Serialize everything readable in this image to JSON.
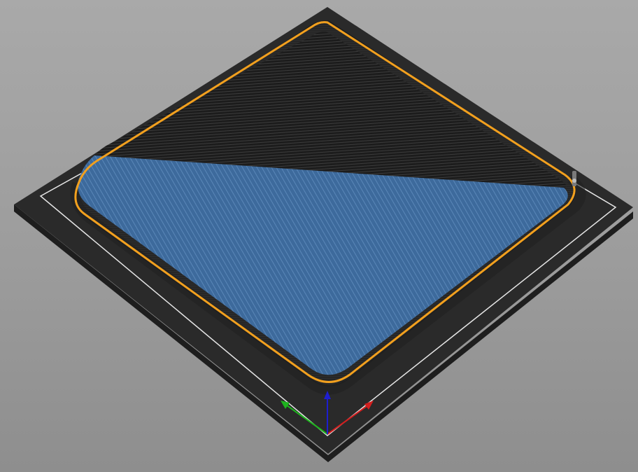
{
  "viewport": {
    "background_top": "#a9a9a9",
    "background_bottom": "#8e8e8e"
  },
  "bed": {
    "surface_color": "#2a2a2a",
    "edge_color": "#1e1e1e",
    "boundary_line_color": "#e6e6e6"
  },
  "print": {
    "wall_color": "#262626",
    "wall_line_color": "#3a3a3a",
    "perimeter_color": "#f2a01e",
    "top_infill_color": "#3d6a9c",
    "infill_line_color": "#5a87b8",
    "interior_floor_color": "#1c1c1c",
    "interior_line_color": "#3c3c3c",
    "top_infill_coverage_fraction": 0.62
  },
  "axes": {
    "x_color": "#d21e1e",
    "y_color": "#1eb41e",
    "z_color": "#1e1ecf"
  }
}
